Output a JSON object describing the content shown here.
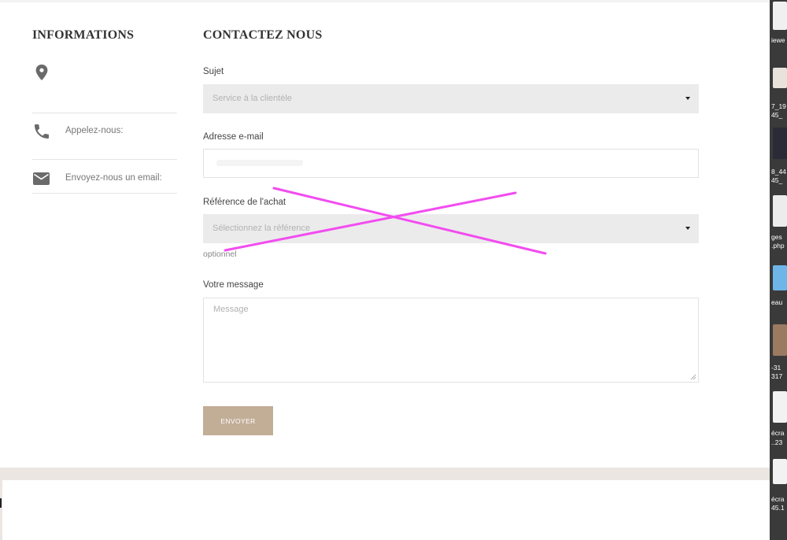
{
  "info": {
    "title": "INFORMATIONS",
    "icons": {
      "location": "map-pin-icon",
      "phone": "phone-icon",
      "email": "envelope-icon"
    },
    "phone_label": "Appelez-nous:",
    "email_label": "Envoyez-nous un email:"
  },
  "contact": {
    "title": "CONTACTEZ NOUS",
    "subject": {
      "label": "Sujet",
      "selected": "Service à la clientèle"
    },
    "email": {
      "label": "Adresse e-mail",
      "value": ""
    },
    "order_ref": {
      "label": "Référence de l'achat",
      "selected": "Sélectionnez la référence",
      "hint": "optionnel"
    },
    "message": {
      "label": "Votre message",
      "placeholder": "Message"
    },
    "send_label": "ENVOYER"
  },
  "desktop_labels": [
    "iewe",
    "7_19",
    "45_",
    "8_44",
    "45_",
    "ges",
    ".php",
    "eau",
    "-31",
    "317",
    "écra",
    "..23",
    "écra",
    "45.1"
  ],
  "colors": {
    "button": "#c2ad97",
    "select_bg": "#ebebeb",
    "footer_band": "#ece6e3",
    "annotation": "#f24cf0"
  }
}
